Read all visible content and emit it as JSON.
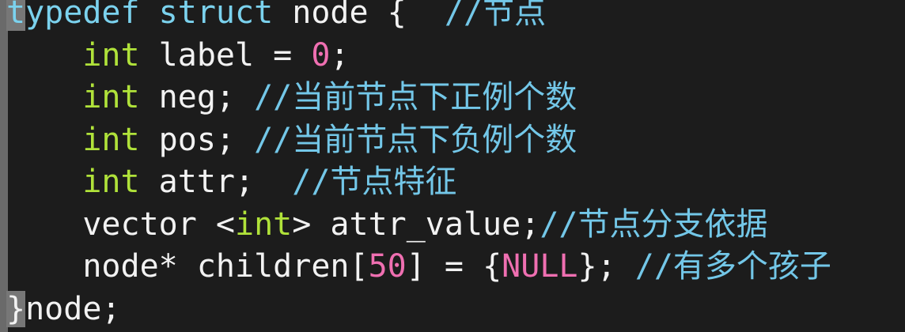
{
  "colors": {
    "background": "#1c1c1c",
    "gutter": "#6a6a6a",
    "keyword": "#7bd2ee",
    "type": "#b0e23a",
    "number": "#ef6fb1",
    "comment": "#73c7e8",
    "text": "#f2f2f2"
  },
  "code": {
    "line1": {
      "cursor_char": "t",
      "kw": "ypedef struct",
      "name": " node { ",
      "comment": " //节点"
    },
    "line2": {
      "indent": "    ",
      "type": "int",
      "mid": " label = ",
      "num": "0",
      "end": ";"
    },
    "line3": {
      "indent": "    ",
      "type": "int",
      "mid": " neg; ",
      "comment": "//当前节点下正例个数"
    },
    "line4": {
      "indent": "    ",
      "type": "int",
      "mid": " pos; ",
      "comment": "//当前节点下负例个数"
    },
    "line5": {
      "indent": "    ",
      "type": "int",
      "mid": " attr;  ",
      "comment": "//节点特征"
    },
    "line6": {
      "indent": "    ",
      "pre": "vector <",
      "type": "int",
      "post": "> attr_value;",
      "comment": "//节点分支依据"
    },
    "line7": {
      "indent": "    ",
      "pre": "node* children[",
      "num": "50",
      "mid": "] = {",
      "null": "NULL",
      "post": "}; ",
      "comment": "//有多个孩子"
    },
    "line8": {
      "brace": "}",
      "rest": "node;"
    }
  }
}
